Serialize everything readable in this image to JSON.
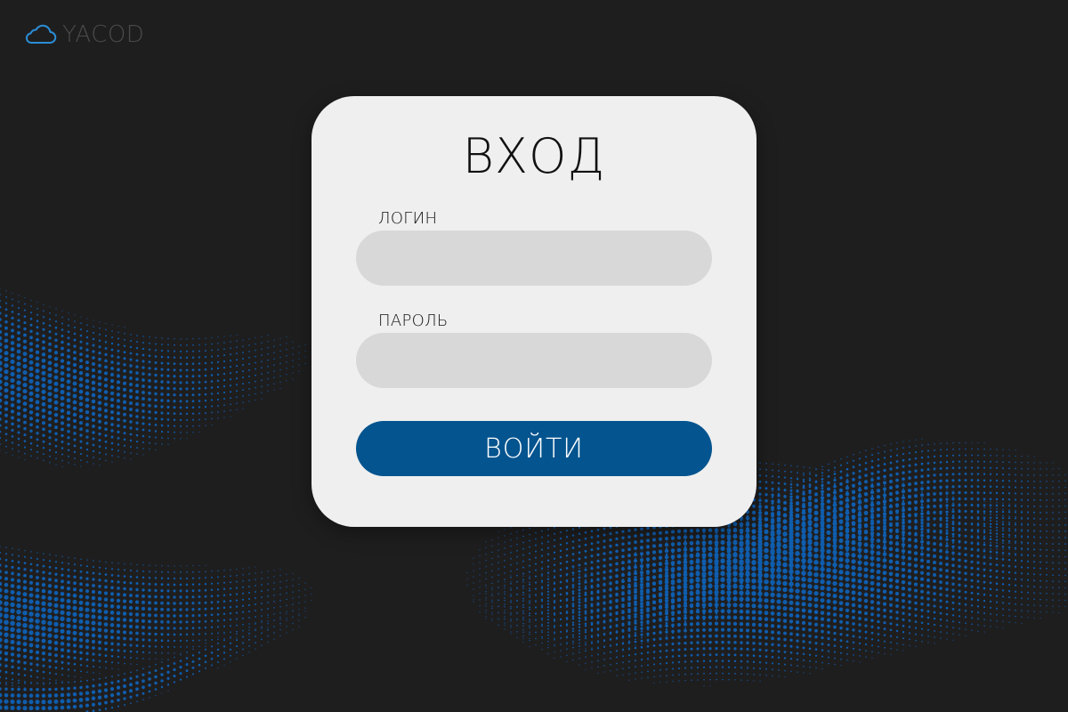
{
  "brand": {
    "logo_text": "YACOD",
    "icon": "cloud-icon",
    "icon_color": "#2a8ed6"
  },
  "login_form": {
    "title": "ВХОД",
    "login_label": "ЛОГИН",
    "login_value": "",
    "password_label": "ПАРОЛЬ",
    "password_value": "",
    "submit_label": "ВОЙТИ"
  },
  "colors": {
    "background": "#1f1e1f",
    "card": "#efefef",
    "input": "#d7d8d7",
    "accent": "#03548f",
    "wave_dots": "#0f5dad"
  }
}
